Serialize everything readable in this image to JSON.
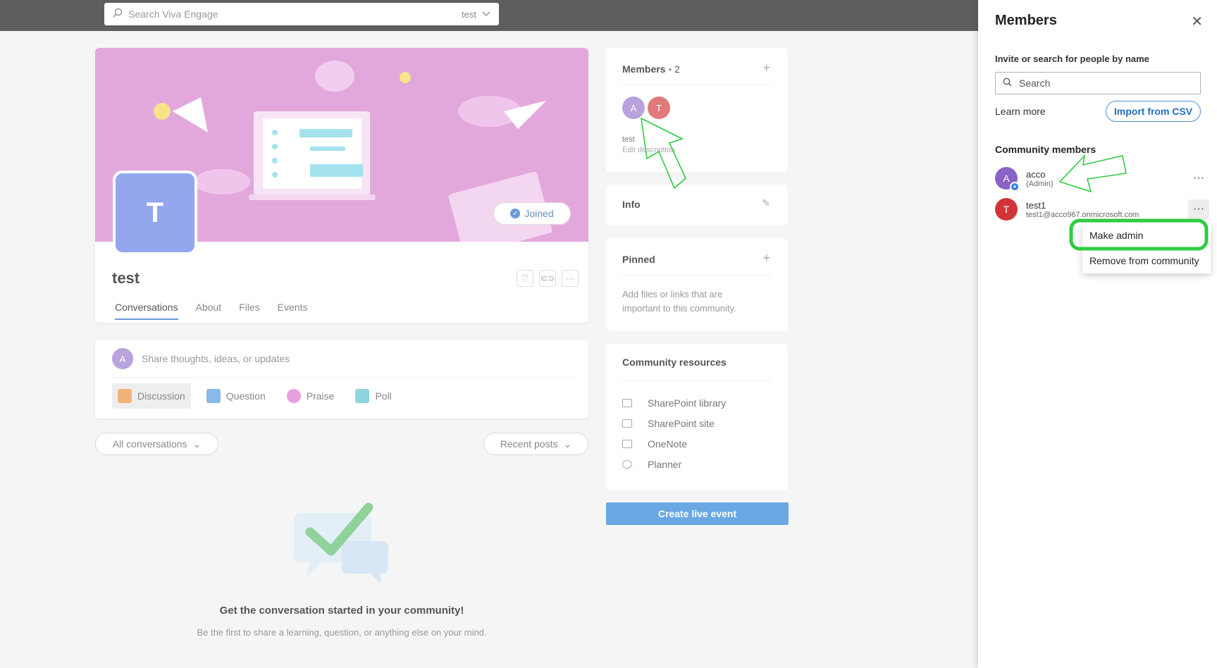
{
  "search": {
    "placeholder": "Search Viva Engage",
    "scope": "test"
  },
  "community": {
    "initial": "T",
    "name": "test",
    "joined_label": "Joined",
    "tabs": [
      "Conversations",
      "About",
      "Files",
      "Events"
    ]
  },
  "composer": {
    "avatar_initial": "A",
    "placeholder": "Share thoughts, ideas, or updates",
    "types": [
      "Discussion",
      "Question",
      "Praise",
      "Poll"
    ]
  },
  "filters": {
    "left": "All conversations",
    "right": "Recent posts"
  },
  "empty": {
    "title": "Get the conversation started in your community!",
    "subtitle": "Be the first to share a learning, question, or anything else on your mind."
  },
  "sidebar": {
    "members": {
      "title": "Members",
      "count": "2",
      "avatars": [
        "A",
        "T"
      ],
      "description": "test",
      "edit_description": "Edit description"
    },
    "info": {
      "title": "Info"
    },
    "pinned": {
      "title": "Pinned",
      "body": "Add files or links that are important to this community."
    },
    "resources": {
      "title": "Community resources",
      "items": [
        "SharePoint library",
        "SharePoint site",
        "OneNote",
        "Planner"
      ]
    },
    "live_event": "Create live event"
  },
  "panel": {
    "title": "Members",
    "invite_label": "Invite or search for people by name",
    "search_placeholder": "Search",
    "learn_more": "Learn more",
    "import_csv": "Import from CSV",
    "community_members": "Community members",
    "members": [
      {
        "initial": "A",
        "name": "acco",
        "sub": "(Admin)",
        "color": "#8a62c6"
      },
      {
        "initial": "T",
        "name": "test1",
        "sub": "test1@acco967.onmicrosoft.com",
        "color": "#d13438"
      }
    ],
    "menu": [
      "Make admin",
      "Remove from community"
    ]
  },
  "colors": {
    "accent": "#1f6fc4",
    "highlight": "#2ecc40",
    "banner": "#e2a8dc"
  }
}
